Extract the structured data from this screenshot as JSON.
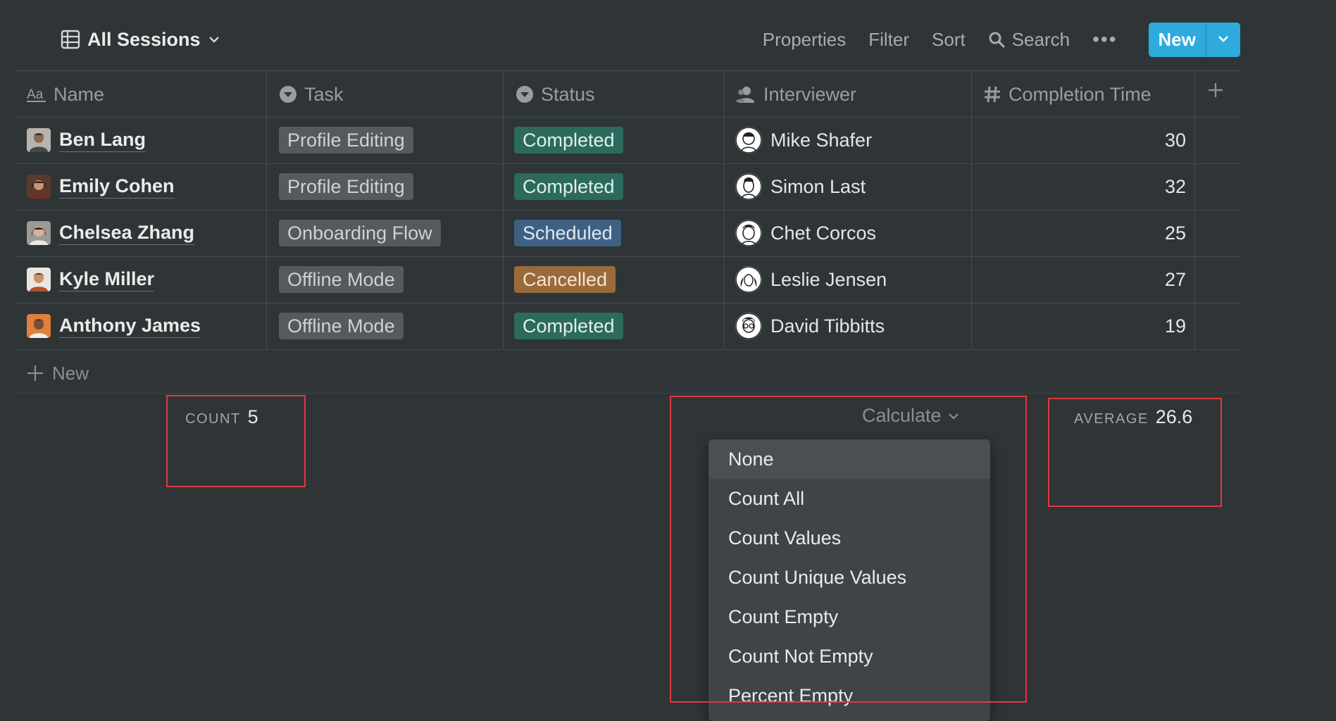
{
  "toolbar": {
    "view_name": "All Sessions",
    "properties": "Properties",
    "filter": "Filter",
    "sort": "Sort",
    "search": "Search",
    "more": "•••",
    "new": "New"
  },
  "columns": [
    {
      "label": "Name",
      "icon": "text-type-icon"
    },
    {
      "label": "Task",
      "icon": "select-icon"
    },
    {
      "label": "Status",
      "icon": "select-icon"
    },
    {
      "label": "Interviewer",
      "icon": "person-icon"
    },
    {
      "label": "Completion Time",
      "icon": "number-icon"
    }
  ],
  "rows": [
    {
      "name": "Ben Lang",
      "task": "Profile Editing",
      "status": "Completed",
      "interviewer": "Mike Shafer",
      "time": "30"
    },
    {
      "name": "Emily Cohen",
      "task": "Profile Editing",
      "status": "Completed",
      "interviewer": "Simon Last",
      "time": "32"
    },
    {
      "name": "Chelsea Zhang",
      "task": "Onboarding Flow",
      "status": "Scheduled",
      "interviewer": "Chet Corcos",
      "time": "25"
    },
    {
      "name": "Kyle Miller",
      "task": "Offline Mode",
      "status": "Cancelled",
      "interviewer": "Leslie Jensen",
      "time": "27"
    },
    {
      "name": "Anthony James",
      "task": "Offline Mode",
      "status": "Completed",
      "interviewer": "David Tibbitts",
      "time": "19"
    }
  ],
  "add_row": "New",
  "footer": {
    "count_label": "COUNT",
    "count_value": "5",
    "calculate": "Calculate",
    "average_label": "AVERAGE",
    "average_value": "26.6"
  },
  "calc_menu": {
    "items": [
      "None",
      "Count All",
      "Count Values",
      "Count Unique Values",
      "Count Empty",
      "Count Not Empty",
      "Percent Empty"
    ],
    "selected": "None"
  },
  "colors": {
    "background": "#2f3437",
    "accent": "#2eaadc",
    "completed": "#2b6a5c",
    "scheduled": "#3e6183",
    "cancelled": "#9b6a3a",
    "highlight": "#e0393e"
  }
}
